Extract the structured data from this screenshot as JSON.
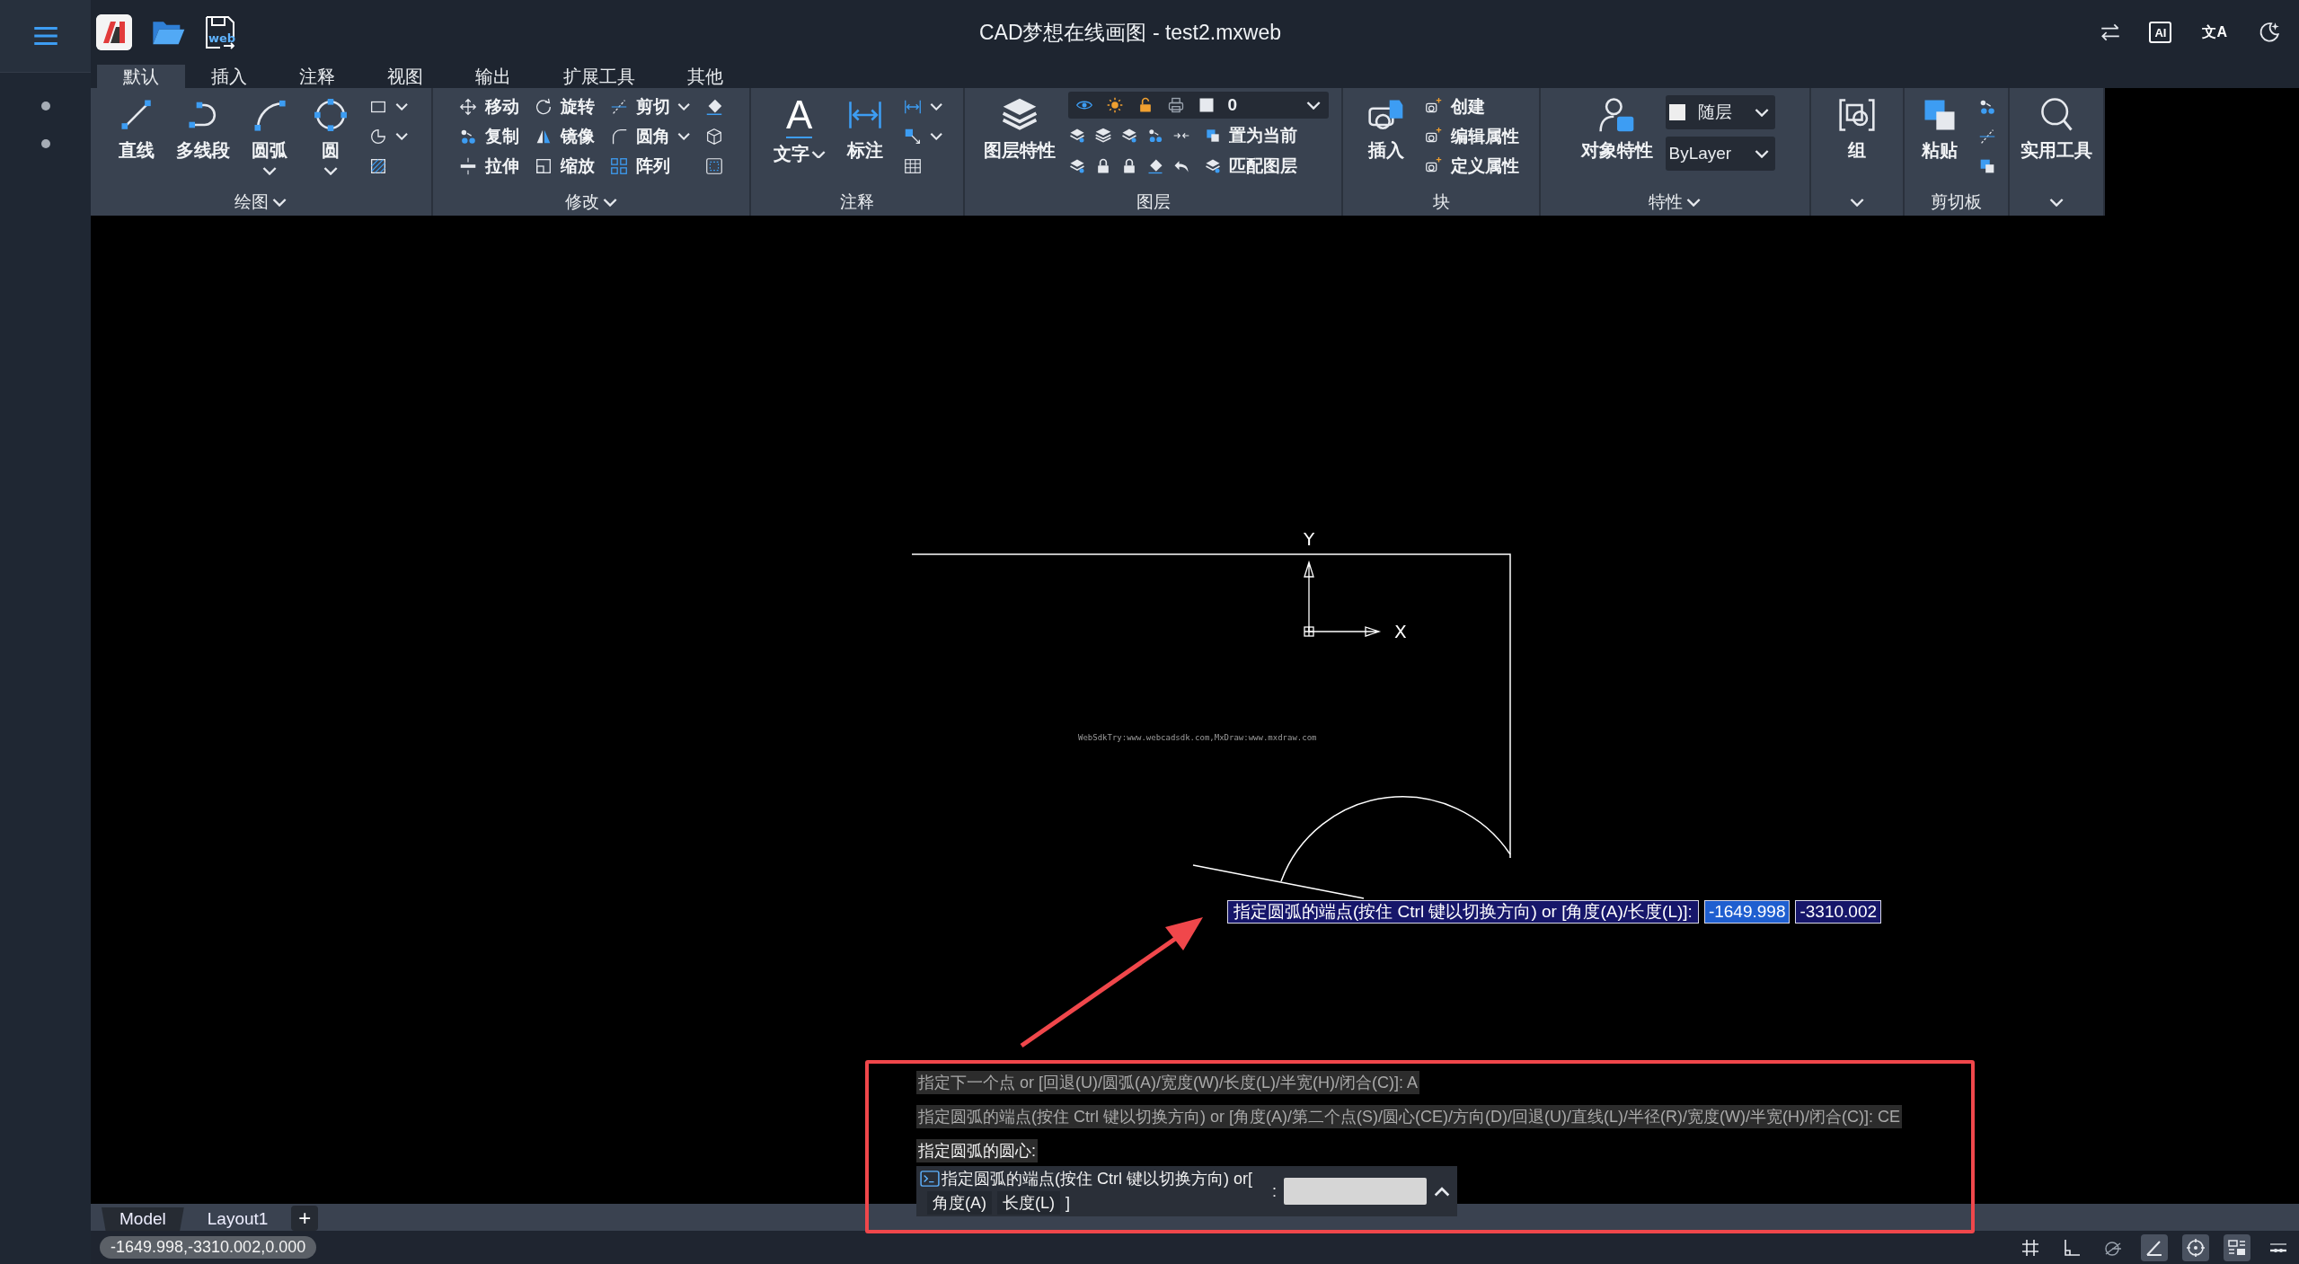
{
  "title_bar": {
    "title": "CAD梦想在线画图 - test2.mxweb",
    "quick_tools": [
      {
        "kind": "logo"
      },
      {
        "kind": "open"
      },
      {
        "kind": "save",
        "glyph": "web"
      }
    ],
    "actions": [
      {
        "kind": "swap"
      },
      {
        "kind": "ai",
        "glyph": "AI"
      },
      {
        "kind": "translate",
        "glyph": "文A"
      },
      {
        "kind": "theme"
      }
    ]
  },
  "ribbon_tabs": [
    {
      "label": "默认",
      "selected": true
    },
    {
      "label": "插入",
      "selected": false
    },
    {
      "label": "注释",
      "selected": false
    },
    {
      "label": "视图",
      "selected": false
    },
    {
      "label": "输出",
      "selected": false
    },
    {
      "label": "扩展工具",
      "selected": false
    },
    {
      "label": "其他",
      "selected": false
    }
  ],
  "ribbon_panels": [
    {
      "title": "绘图",
      "caret": true,
      "columns": [
        {
          "kind": "large",
          "label": "直线",
          "caret": false
        },
        {
          "kind": "large",
          "label": "多线段",
          "caret": false
        },
        {
          "kind": "large",
          "label": "圆弧",
          "caret": true
        },
        {
          "kind": "large",
          "label": "圆",
          "caret": true
        },
        {
          "kind": "stack",
          "tools": [
            {
              "caret": true
            },
            {
              "caret": true
            },
            {
              "caret": false
            }
          ]
        }
      ]
    },
    {
      "title": "修改",
      "caret": true,
      "columns": [
        {
          "kind": "stack",
          "tools": [
            {
              "label": "移动",
              "caret": false
            },
            {
              "label": "复制",
              "caret": false
            },
            {
              "label": "拉伸",
              "caret": false
            }
          ]
        },
        {
          "kind": "stack",
          "tools": [
            {
              "label": "旋转",
              "caret": false
            },
            {
              "label": "镜像",
              "caret": false
            },
            {
              "label": "缩放",
              "caret": false
            }
          ]
        },
        {
          "kind": "stack",
          "tools": [
            {
              "label": "剪切",
              "caret": true
            },
            {
              "label": "圆角",
              "caret": true
            },
            {
              "label": "阵列",
              "caret": false
            }
          ]
        },
        {
          "kind": "stack",
          "tools": [
            {
              "caret": false
            },
            {
              "caret": false
            },
            {
              "caret": false
            }
          ]
        }
      ]
    },
    {
      "title": "注释",
      "caret": false,
      "columns": [
        {
          "kind": "split",
          "label": "文字",
          "caret": true,
          "glyph": "A"
        },
        {
          "kind": "large",
          "label": "标注",
          "caret": false
        },
        {
          "kind": "stack",
          "tools": [
            {
              "caret": true
            },
            {
              "caret": true
            },
            {
              "caret": false
            }
          ]
        }
      ]
    },
    {
      "title": "图层",
      "caret": false,
      "columns": [
        {
          "kind": "large",
          "label": "图层特性",
          "caret": false
        },
        {
          "kind": "layer",
          "value": "0",
          "rows": [
            {
              "label": "置为当前"
            },
            {
              "label": "匹配图层"
            }
          ]
        }
      ]
    },
    {
      "title": "块",
      "caret": false,
      "columns": [
        {
          "kind": "large",
          "label": "插入",
          "caret": false
        },
        {
          "kind": "stack",
          "tools": [
            {
              "label": "创建",
              "caret": false
            },
            {
              "label": "编辑属性",
              "caret": false
            },
            {
              "label": "定义属性",
              "caret": false
            }
          ]
        }
      ]
    },
    {
      "title": "特性",
      "caret": true,
      "columns": [
        {
          "kind": "large",
          "label": "对象特性",
          "caret": false
        },
        {
          "kind": "dropdowns",
          "items": [
            {
              "value": "随层",
              "swatch": true
            },
            {
              "value": "ByLayer",
              "swatch": false
            }
          ]
        }
      ]
    },
    {
      "caret": true,
      "columns": [
        {
          "kind": "large",
          "label": "组",
          "caret": false
        }
      ]
    },
    {
      "title": "剪切板",
      "caret": false,
      "columns": [
        {
          "kind": "large",
          "label": "粘贴",
          "caret": false
        },
        {
          "kind": "stack",
          "tools": [
            {
              "caret": false
            },
            {
              "caret": false
            },
            {
              "caret": false
            }
          ]
        }
      ]
    },
    {
      "caret": true,
      "columns": [
        {
          "kind": "large",
          "label": "实用工具",
          "caret": false
        }
      ]
    }
  ],
  "canvas": {
    "y_label": "Y",
    "x_label": "X",
    "note": "WebSdkTry:www.webcadsdk.com,MxDraw:www.mxdraw.com"
  },
  "dynamic_input": {
    "prompt": "指定圆弧的端点(按住 Ctrl 键以切换方向) or [角度(A)/长度(L)]:",
    "fields": [
      {
        "value": "-1649.998",
        "selected": true
      },
      {
        "value": "-3310.002",
        "selected": false
      }
    ]
  },
  "command_line": {
    "history": [
      {
        "text": "指定下一个点 or [回退(U)/圆弧(A)/宽度(W)/长度(L)/半宽(H)/闭合(C)]: A",
        "bright": false
      },
      {
        "text": "指定圆弧的端点(按住 Ctrl 键以切换方向) or [角度(A)/第二个点(S)/圆心(CE)/方向(D)/回退(U)/直线(L)/半径(R)/宽度(W)/半宽(H)/闭合(C)]: CE",
        "bright": false
      },
      {
        "text": "指定圆弧的圆心:",
        "bright": true
      }
    ],
    "prompt": "指定圆弧的端点(按住 Ctrl 键以切换方向) or[",
    "options": [
      "角度(A)",
      "长度(L)"
    ],
    "closing": "]",
    "separator": ":"
  },
  "layout_tabs": [
    {
      "label": "Model",
      "selected": true
    },
    {
      "label": "Layout1",
      "selected": false
    }
  ],
  "add_tab": "+",
  "status_bar": {
    "coordinates": "-1649.998,-3310.002,0.000",
    "toggles": [
      {
        "kind": "grid",
        "on": false
      },
      {
        "kind": "ortho",
        "on": false
      },
      {
        "kind": "polar",
        "on": false
      },
      {
        "kind": "angle",
        "on": true
      },
      {
        "kind": "snap",
        "on": true
      },
      {
        "kind": "dynamic",
        "on": true
      },
      {
        "kind": "lineweight",
        "on": false
      }
    ]
  }
}
